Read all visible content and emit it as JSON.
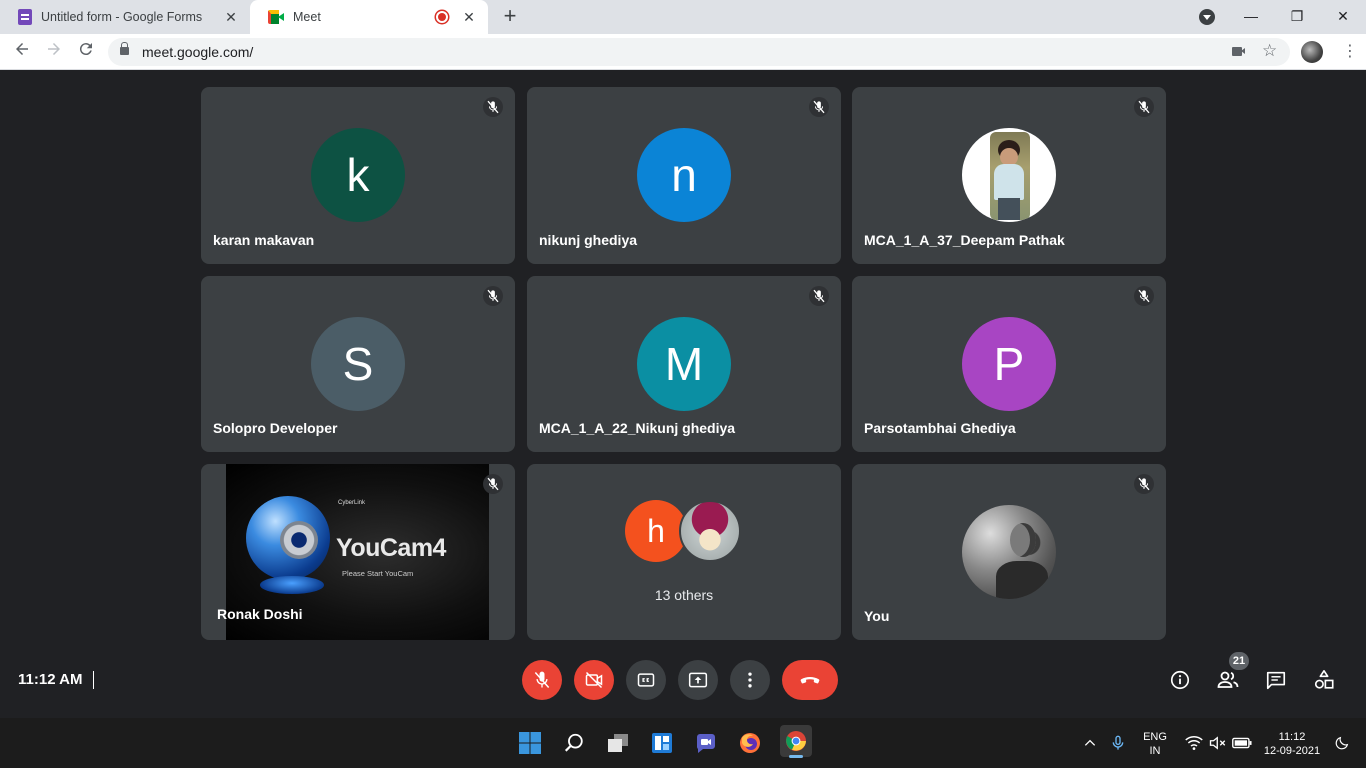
{
  "browser": {
    "tabs": [
      {
        "title": "Untitled form - Google Forms",
        "active": false
      },
      {
        "title": "Meet",
        "active": true,
        "recording": true
      }
    ],
    "url": "meet.google.com/",
    "window_controls": {
      "minimize": "—",
      "restore": "❐",
      "close": "✕"
    }
  },
  "meeting": {
    "tiles": [
      {
        "name": "karan makavan",
        "initial": "k",
        "avatar_color": "#0d5243",
        "muted": true
      },
      {
        "name": "nikunj ghediya",
        "initial": "n",
        "avatar_color": "#0b84d6",
        "muted": true
      },
      {
        "name": "MCA_1_A_37_Deepam Pathak",
        "avatar": "photo",
        "muted": true
      },
      {
        "name": "Solopro Developer",
        "initial": "S",
        "avatar_color": "#4b5d67",
        "muted": true
      },
      {
        "name": "MCA_1_A_22_Nikunj ghediya",
        "initial": "M",
        "avatar_color": "#0b8fa3",
        "muted": true
      },
      {
        "name": "Parsotambhai Ghediya",
        "initial": "P",
        "avatar_color": "#a845c3",
        "muted": true
      },
      {
        "name": "Ronak Doshi",
        "video": "YouCam placeholder",
        "muted": true
      },
      {
        "name": "13 others",
        "initial": "h",
        "avatar_color": "#f4511e"
      },
      {
        "name": "You",
        "avatar": "photo",
        "muted": true
      }
    ],
    "youcam": {
      "brand": "CyberLink",
      "title": "YouCam4",
      "subtitle": "Please Start YouCam"
    },
    "time": "11:12 AM",
    "participants_count": "21",
    "controls": [
      "mic-off",
      "camera-off",
      "captions",
      "present",
      "more-options",
      "leave-call"
    ],
    "right_tools": [
      "info",
      "people",
      "chat",
      "activities"
    ]
  },
  "taskbar": {
    "language": "ENG",
    "region": "IN",
    "time": "11:12",
    "date": "12-09-2021"
  },
  "colors": {
    "meet_bg": "#202124",
    "tile_bg": "#3c4043",
    "danger": "#ea4335"
  }
}
